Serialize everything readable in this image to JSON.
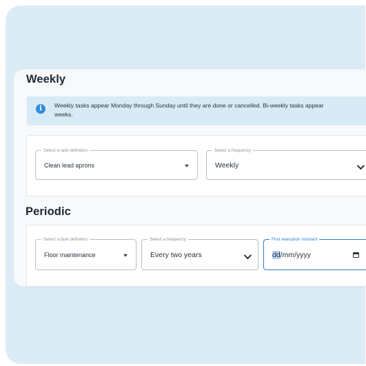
{
  "weekly": {
    "title": "Weekly",
    "info_icon": "info-icon",
    "info_text": "Weekly tasks appear Monday through Sunday until they are done or cancelled. Bi-weekly tasks appear",
    "info_text_2": "weeks.",
    "task_definition": {
      "label": "Select a task definition",
      "value": "Clean lead aprons"
    },
    "frequency": {
      "label": "Select a frequency",
      "value": "Weekly"
    }
  },
  "periodic": {
    "title": "Periodic",
    "task_definition": {
      "label": "Select a task definition",
      "value": "Floor maintenance"
    },
    "frequency": {
      "label": "Select a frequency",
      "value": "Every two years"
    },
    "first_execution": {
      "label": "First execution moment",
      "value_selected": "dd",
      "value_rest": "/mm/yyyy",
      "icon": "calendar-icon"
    }
  },
  "colors": {
    "accent": "#2b7ccf",
    "info_bg": "#d8eaf6",
    "page_bg": "#dcecf6"
  }
}
